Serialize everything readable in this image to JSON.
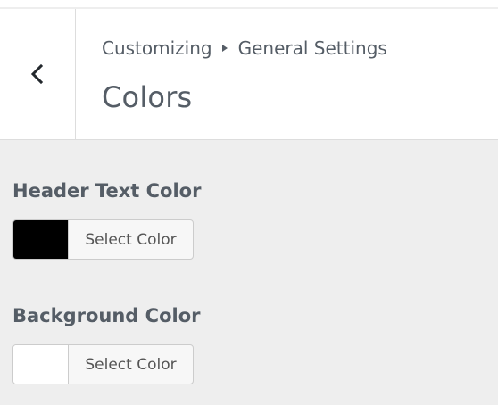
{
  "header": {
    "back_icon": "chevron-left-icon",
    "breadcrumb": {
      "root": "Customizing",
      "separator_icon": "triangle-right-icon",
      "parent": "General Settings"
    },
    "title": "Colors"
  },
  "controls": [
    {
      "label": "Header Text Color",
      "button_label": "Select Color",
      "color": "#000000"
    },
    {
      "label": "Background Color",
      "button_label": "Select Color",
      "color": "#ffffff"
    }
  ]
}
